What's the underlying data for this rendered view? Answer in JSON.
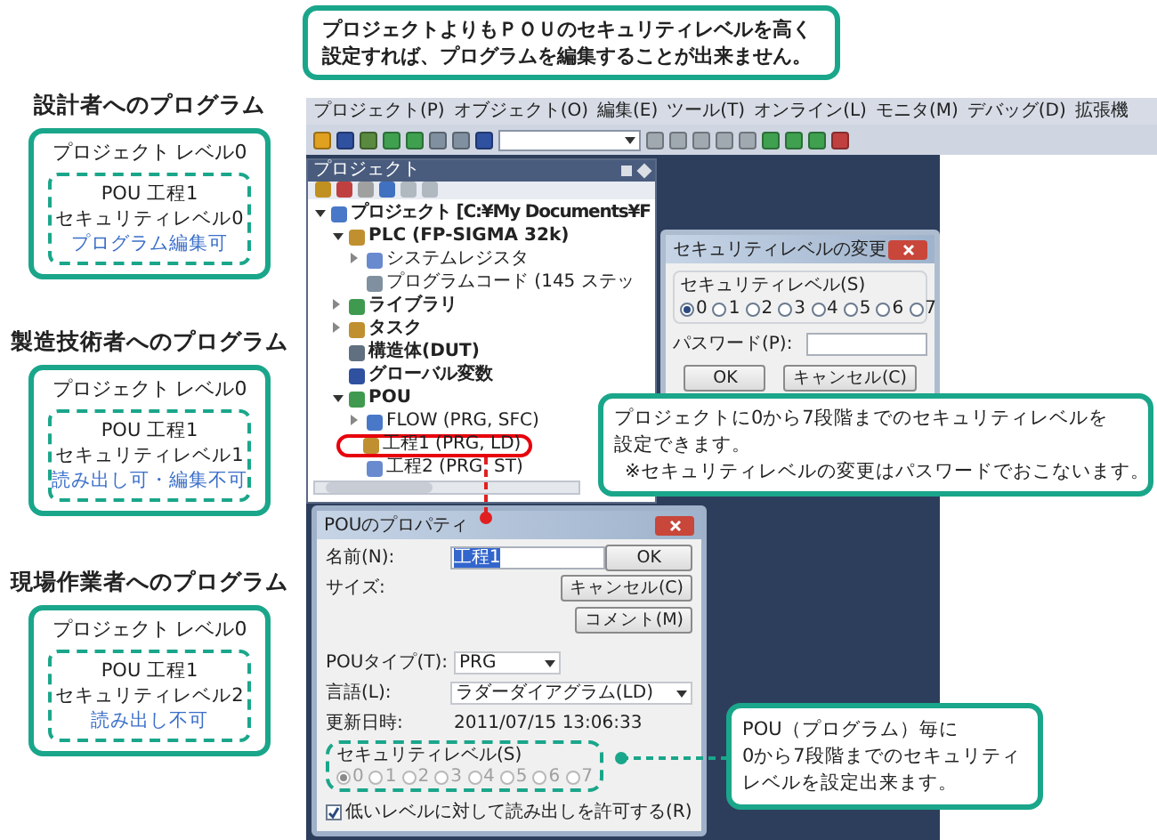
{
  "top_note": [
    "プロジェクトよりもＰＯＵのセキュリティレベルを高く",
    "設定すれば、プログラムを編集することが出来ません。"
  ],
  "role_cards": [
    {
      "heading": "設計者へのプログラム",
      "project_level": "プロジェクト レベル0",
      "pou_name": "POU 工程1",
      "pou_level": "セキュリティレベル0",
      "permission": "プログラム編集可"
    },
    {
      "heading": "製造技術者へのプログラム",
      "project_level": "プロジェクト レベル0",
      "pou_name": "POU 工程1",
      "pou_level": "セキュリティレベル1",
      "permission": "読み出し可・編集不可"
    },
    {
      "heading": "現場作業者へのプログラム",
      "project_level": "プロジェクト レベル0",
      "pou_name": "POU 工程1",
      "pou_level": "セキュリティレベル2",
      "permission": "読み出し不可"
    }
  ],
  "app": {
    "menu": [
      "プロジェクト(P)",
      "オブジェクト(O)",
      "編集(E)",
      "ツール(T)",
      "オンライン(L)",
      "モニタ(M)",
      "デバッグ(D)",
      "拡張機"
    ],
    "project_panel": {
      "title": "プロジェクト",
      "tree": [
        {
          "label": "プロジェクト [C:¥My Documents¥F",
          "expanded": true,
          "children": [
            {
              "label": "PLC (FP-SIGMA 32k)",
              "expanded": true,
              "children": [
                {
                  "label": "システムレジスタ",
                  "expanded": false
                },
                {
                  "label": "プログラムコード (145 ステッ"
                }
              ]
            },
            {
              "label": "ライブラリ",
              "expanded": false
            },
            {
              "label": "タスク",
              "expanded": false
            },
            {
              "label": "構造体(DUT)"
            },
            {
              "label": "グローバル変数"
            },
            {
              "label": "POU",
              "expanded": true,
              "children": [
                {
                  "label": "FLOW (PRG, SFC)",
                  "expanded": false,
                  "circled": false
                },
                {
                  "label": "工程1 (PRG, LD)",
                  "circled": true
                },
                {
                  "label": "工程2 (PRG, ST)",
                  "circled": false
                }
              ]
            }
          ]
        }
      ]
    },
    "security_dialog": {
      "title": "セキュリティレベルの変更",
      "group_label": "セキュリティレベル(S)",
      "options": [
        {
          "label": "0",
          "selected": true
        },
        {
          "label": "1",
          "selected": false
        },
        {
          "label": "2",
          "selected": false
        },
        {
          "label": "3",
          "selected": false
        },
        {
          "label": "4",
          "selected": false
        },
        {
          "label": "5",
          "selected": false
        },
        {
          "label": "6",
          "selected": false
        },
        {
          "label": "7",
          "selected": false
        }
      ],
      "password_label": "パスワード(P):",
      "buttons": [
        "OK",
        "キャンセル(C)"
      ]
    },
    "pou_dialog": {
      "title": "POUのプロパティ",
      "name_label": "名前(N):",
      "name_value": "工程1",
      "size_label": "サイズ:",
      "buttons": [
        "OK",
        "キャンセル(C)",
        "コメント(M)"
      ],
      "type_label": "POUタイプ(T):",
      "type_value": "PRG",
      "language_label": "言語(L):",
      "language_value": "ラダーダイアグラム(LD)",
      "date_label": "更新日時:",
      "date_value": "2011/07/15 13:06:33",
      "group_label": "セキュリティレベル(S)",
      "options_disabled": true,
      "options": [
        {
          "label": "0",
          "selected": true
        },
        {
          "label": "1",
          "selected": false
        },
        {
          "label": "2",
          "selected": false
        },
        {
          "label": "3",
          "selected": false
        },
        {
          "label": "4",
          "selected": false
        },
        {
          "label": "5",
          "selected": false
        },
        {
          "label": "6",
          "selected": false
        },
        {
          "label": "7",
          "selected": false
        }
      ],
      "checkbox": {
        "label": "低いレベルに対して読み出しを許可する(R)",
        "checked": true
      }
    }
  },
  "callouts": [
    {
      "lines": [
        "プロジェクトに0から7段階までのセキュリティレベルを",
        "設定できます。",
        "※セキュリティレベルの変更はパスワードでおこないます。"
      ]
    },
    {
      "lines": [
        "POU（プログラム）毎に",
        "0から7段階までのセキュリティ",
        "レベルを設定出来ます。"
      ]
    }
  ]
}
